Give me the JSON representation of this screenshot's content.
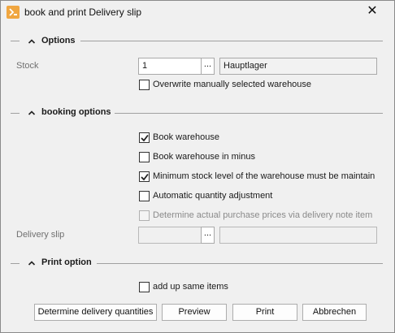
{
  "window": {
    "title": "book and print Delivery slip",
    "close_glyph": "✕",
    "icon": "app-icon"
  },
  "sections": {
    "options": {
      "title": "Options",
      "stock_label": "Stock",
      "stock_value": "1",
      "stock_lookup": "...",
      "stock_name": "Hauptlager",
      "overwrite_label": "Overwrite manually selected warehouse",
      "overwrite_checked": false
    },
    "booking": {
      "title": "booking options",
      "checks": [
        {
          "label": "Book warehouse",
          "checked": true,
          "disabled": false
        },
        {
          "label": "Book warehouse in minus",
          "checked": false,
          "disabled": false
        },
        {
          "label": "Minimum stock level of the warehouse must be maintain",
          "checked": true,
          "disabled": false
        },
        {
          "label": "Automatic quantity adjustment",
          "checked": false,
          "disabled": false
        },
        {
          "label": "Determine actual purchase prices via delivery note item",
          "checked": false,
          "disabled": true
        }
      ],
      "delivery_slip_label": "Delivery slip",
      "delivery_slip_value": "",
      "delivery_slip_lookup": "...",
      "delivery_slip_name": ""
    },
    "print": {
      "title": "Print option",
      "add_up_label": "add up same items",
      "add_up_checked": false
    }
  },
  "buttons": {
    "determine": "Determine delivery quantities",
    "preview": "Preview",
    "print": "Print",
    "cancel": "Abbrechen"
  }
}
